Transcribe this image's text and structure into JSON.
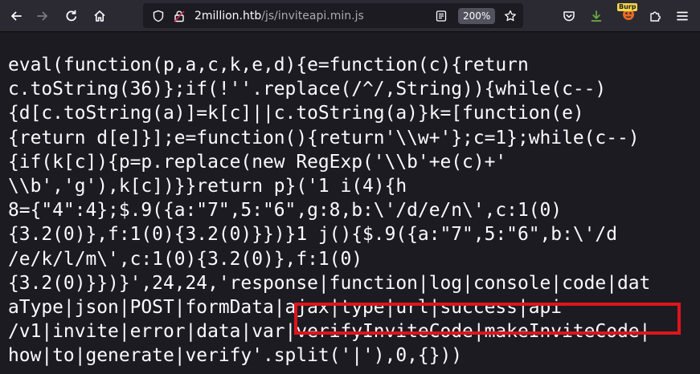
{
  "browser": {
    "url_domain": "2million.htb",
    "url_path": "/js/inviteapi.min.js",
    "zoom": "200%",
    "extension_badge": "Burp"
  },
  "icons": {
    "back": "back-arrow-icon",
    "forward": "forward-arrow-icon",
    "reload": "reload-icon",
    "home": "home-icon",
    "tracking": "shield-icon",
    "connection": "not-secure-lock-icon",
    "reader": "reader-view-icon",
    "bookmark": "star-icon",
    "pocket": "pocket-icon",
    "downloads": "download-icon",
    "extensions": "puzzle-icon",
    "menu": "hamburger-menu-icon"
  },
  "colors": {
    "page_background": "#1c1b22",
    "text": "#fbfbfe",
    "toolbar": "#2b2a33",
    "highlight": "#e0141c"
  },
  "content": {
    "lines": [
      "eval(function(p,a,c,k,e,d){e=function(c){return",
      "c.toString(36)};if(!''.replace(/^/,String)){while(c--)",
      "{d[c.toString(a)]=k[c]||c.toString(a)}k=[function(e)",
      "{return d[e]}];e=function(){return'\\\\w+'};c=1};while(c--)",
      "{if(k[c]){p=p.replace(new RegExp('\\\\b'+e(c)+'",
      "\\\\b','g'),k[c])}}return p}('1 i(4){h",
      "8={\"4\":4};$.9({a:\"7\",5:\"6\",g:8,b:\\'/d/e/n\\',c:1(0)",
      "{3.2(0)},f:1(0){3.2(0)}})}1 j(){$.9({a:\"7\",5:\"6\",b:\\'/d",
      "/e/k/l/m\\',c:1(0){3.2(0)},f:1(0)",
      "{3.2(0)}})}',24,24,'response|function|log|console|code|dat",
      "aType|json|POST|formData|ajax|type|url|success|api",
      "/v1|invite|error|data|var|verifyInviteCode|makeInviteCode|",
      "how|to|generate|verify'.split('|'),0,{}))"
    ]
  }
}
